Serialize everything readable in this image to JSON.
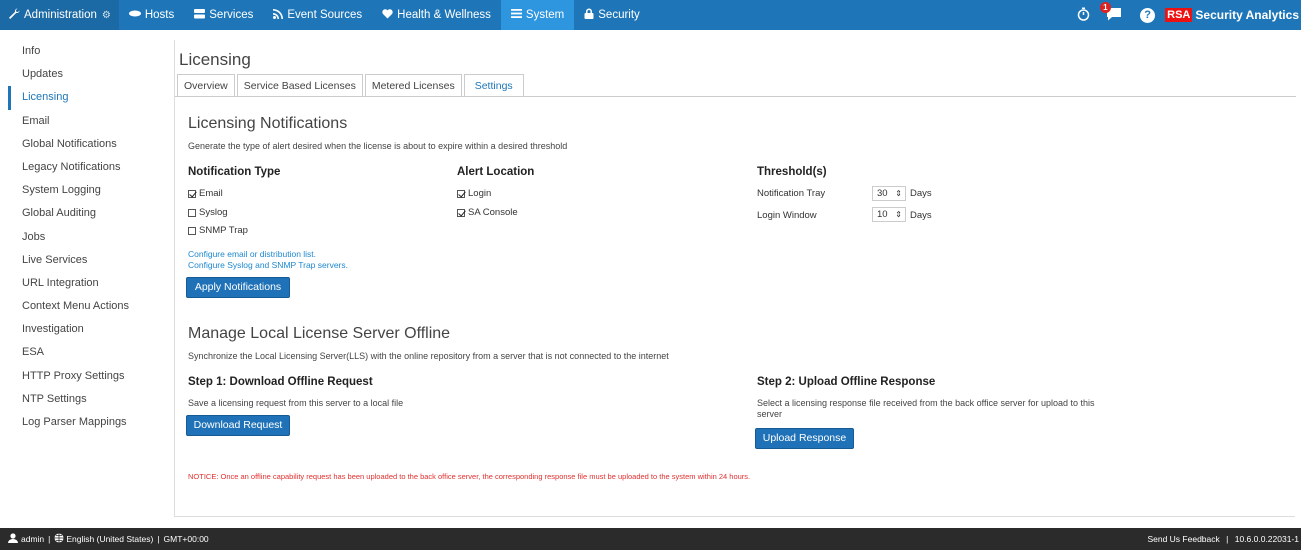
{
  "nav": {
    "admin_label": "Administration",
    "items": [
      {
        "label": "Hosts",
        "icon": "hosts-icon"
      },
      {
        "label": "Services",
        "icon": "services-icon"
      },
      {
        "label": "Event Sources",
        "icon": "rss-icon"
      },
      {
        "label": "Health & Wellness",
        "icon": "heart-icon"
      },
      {
        "label": "System",
        "icon": "list-icon"
      },
      {
        "label": "Security",
        "icon": "lock-icon"
      }
    ],
    "notification_count": "1",
    "rsa_logo": "RSA",
    "brand": "Security Analytics",
    "colors": {
      "bar": "#1e76b8",
      "active": "#2e95df"
    }
  },
  "sidebar": {
    "items": [
      "Info",
      "Updates",
      "Licensing",
      "Email",
      "Global Notifications",
      "Legacy Notifications",
      "System Logging",
      "Global Auditing",
      "Jobs",
      "Live Services",
      "URL Integration",
      "Context Menu Actions",
      "Investigation",
      "ESA",
      "HTTP Proxy Settings",
      "NTP Settings",
      "Log Parser Mappings"
    ],
    "active": "Licensing"
  },
  "main": {
    "title": "Licensing",
    "tabs": [
      "Overview",
      "Service Based Licenses",
      "Metered Licenses",
      "Settings"
    ],
    "active_tab": "Settings"
  },
  "notifications": {
    "title": "Licensing Notifications",
    "description": "Generate the type of alert desired when the license is about to expire within a desired threshold",
    "type_head": "Notification Type",
    "types": [
      {
        "label": "Email",
        "checked": true
      },
      {
        "label": "Syslog",
        "checked": false
      },
      {
        "label": "SNMP Trap",
        "checked": false
      }
    ],
    "location_head": "Alert Location",
    "locations": [
      {
        "label": "Login",
        "checked": true
      },
      {
        "label": "SA Console",
        "checked": true
      }
    ],
    "threshold_head": "Threshold(s)",
    "thresholds": [
      {
        "label": "Notification Tray",
        "value": "30",
        "unit": "Days"
      },
      {
        "label": "Login Window",
        "value": "10",
        "unit": "Days"
      }
    ],
    "link_email": "Configure email or distribution list.",
    "link_syslog": "Configure Syslog and SNMP Trap servers.",
    "apply_button": "Apply Notifications"
  },
  "offline": {
    "title": "Manage Local License Server Offline",
    "description": "Synchronize the Local Licensing Server(LLS) with the online repository from a server that is not connected to the internet",
    "step1_head": "Step 1: Download Offline Request",
    "step1_desc": "Save a licensing request from this server to a local file",
    "step1_button": "Download Request",
    "step2_head": "Step 2: Upload Offline Response",
    "step2_desc": "Select a licensing response file received from the back office server for upload to this server",
    "step2_button": "Upload Response",
    "notice": "NOTICE: Once an offline capability request has been uploaded to the back office server, the corresponding response file must be uploaded to the system within 24 hours."
  },
  "footer": {
    "user": "admin",
    "language": "English (United States)",
    "timezone": "GMT+00:00",
    "feedback": "Send Us Feedback",
    "version": "10.6.0.0.22031-1"
  }
}
